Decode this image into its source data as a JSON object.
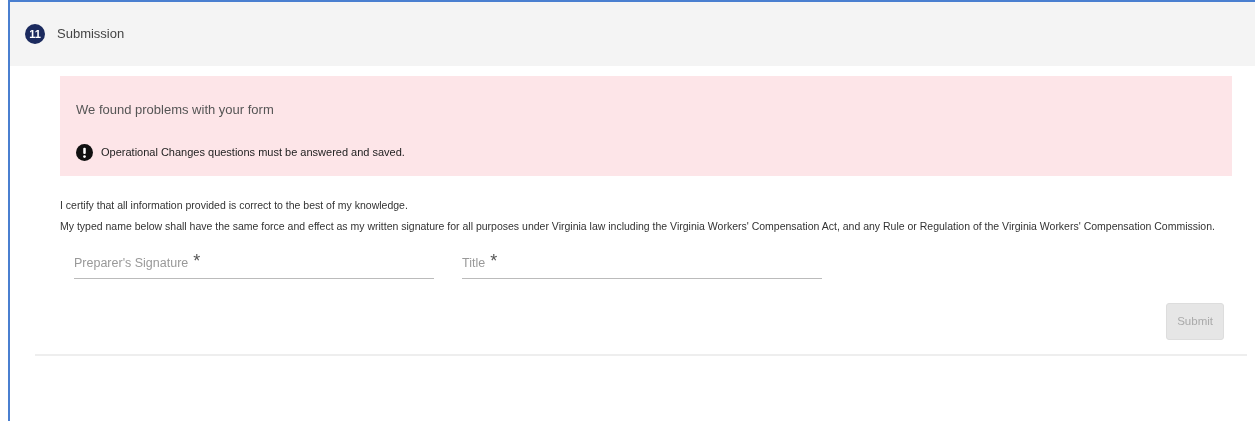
{
  "section": {
    "number": "11",
    "title": "Submission"
  },
  "alert": {
    "heading": "We found problems with your form",
    "errors": [
      "Operational Changes questions must be answered and saved."
    ]
  },
  "certification": [
    "I certify that all information provided is correct to the best of my knowledge.",
    "My typed name below shall have the same force and effect as my written signature for all purposes under Virginia law including the Virginia Workers' Compensation Act, and any Rule or Regulation of the Virginia Workers' Compensation Commission."
  ],
  "fields": [
    {
      "placeholder": "Preparer's Signature",
      "required_mark": "*"
    },
    {
      "placeholder": "Title",
      "required_mark": "*"
    }
  ],
  "submit": {
    "label": "Submit",
    "disabled": true
  }
}
